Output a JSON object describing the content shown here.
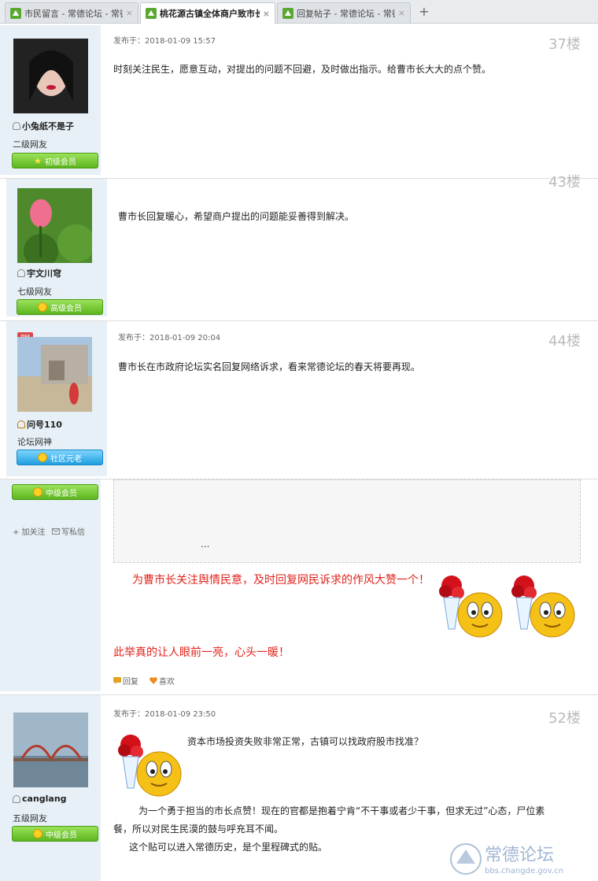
{
  "tabs": [
    {
      "title": "市民留言 - 常德论坛 - 常德",
      "active": false
    },
    {
      "title": "桃花源古镇全体商户致市长的一",
      "active": true
    },
    {
      "title": "回复帖子 - 常德论坛 - 常德",
      "active": false
    }
  ],
  "new_tab": "+",
  "tab_close": "×",
  "posts": [
    {
      "user": "小兔纸不是子",
      "level": "二级网友",
      "badge": "初级会员",
      "date": "发布于：2018-01-09 15:57",
      "floor": "37楼",
      "content": "时刻关注民生，愿意互动，对提出的问题不回避，及时做出指示。给曹市长大大的点个赞。"
    },
    {
      "user": "宇文川穹",
      "level": "七级网友",
      "badge": "高级会员",
      "floor": "43楼",
      "content": "曹市长回复暖心，希望商户提出的问题能妥善得到解决。"
    },
    {
      "user": "问号110",
      "level": "论坛网神",
      "badge": "社区元老",
      "date": "发布于：2018-01-09 20:04",
      "floor": "44楼",
      "content": "曹市长在市政府论坛实名回复网络诉求，看来常德论坛的春天将要再现。"
    },
    {
      "badge": "中级会员",
      "follow": "+ 加关注",
      "message": "写私信",
      "quote_ellipsis": "...",
      "content_red_1": "为曹市长关注舆情民意，及时回复网民诉求的作风大赞一个！",
      "content_red_2": "此举真的让人眼前一亮，心头一暖！",
      "reply": "回复",
      "like": "喜欢"
    },
    {
      "user": "canglang",
      "level": "五级网友",
      "badge": "中级会员",
      "date": "发布于：2018-01-09 23:50",
      "floor": "52楼",
      "line1": "资本市场投资失败非常正常，古镇可以找政府股市找准？",
      "line2": "为一个勇于担当的市长点赞！现在的官都是抱着宁肯“不干事或者少干事，但求无过”心态，尸位素",
      "line3": "餐，所以对民生民漠的鼓与呼充耳不闻。",
      "line4": "这个贴可以进入常德历史，是个里程碑式的贴。"
    }
  ],
  "pm_label": "PM",
  "watermark": {
    "brand": "常德论坛",
    "url": "bbs.changde.gov.cn"
  },
  "colors": {
    "accent_red": "#e0231b",
    "sidebar_bg": "#e6f0f6",
    "badge_green": "#5cb51e",
    "badge_blue": "#1f9ee0"
  }
}
